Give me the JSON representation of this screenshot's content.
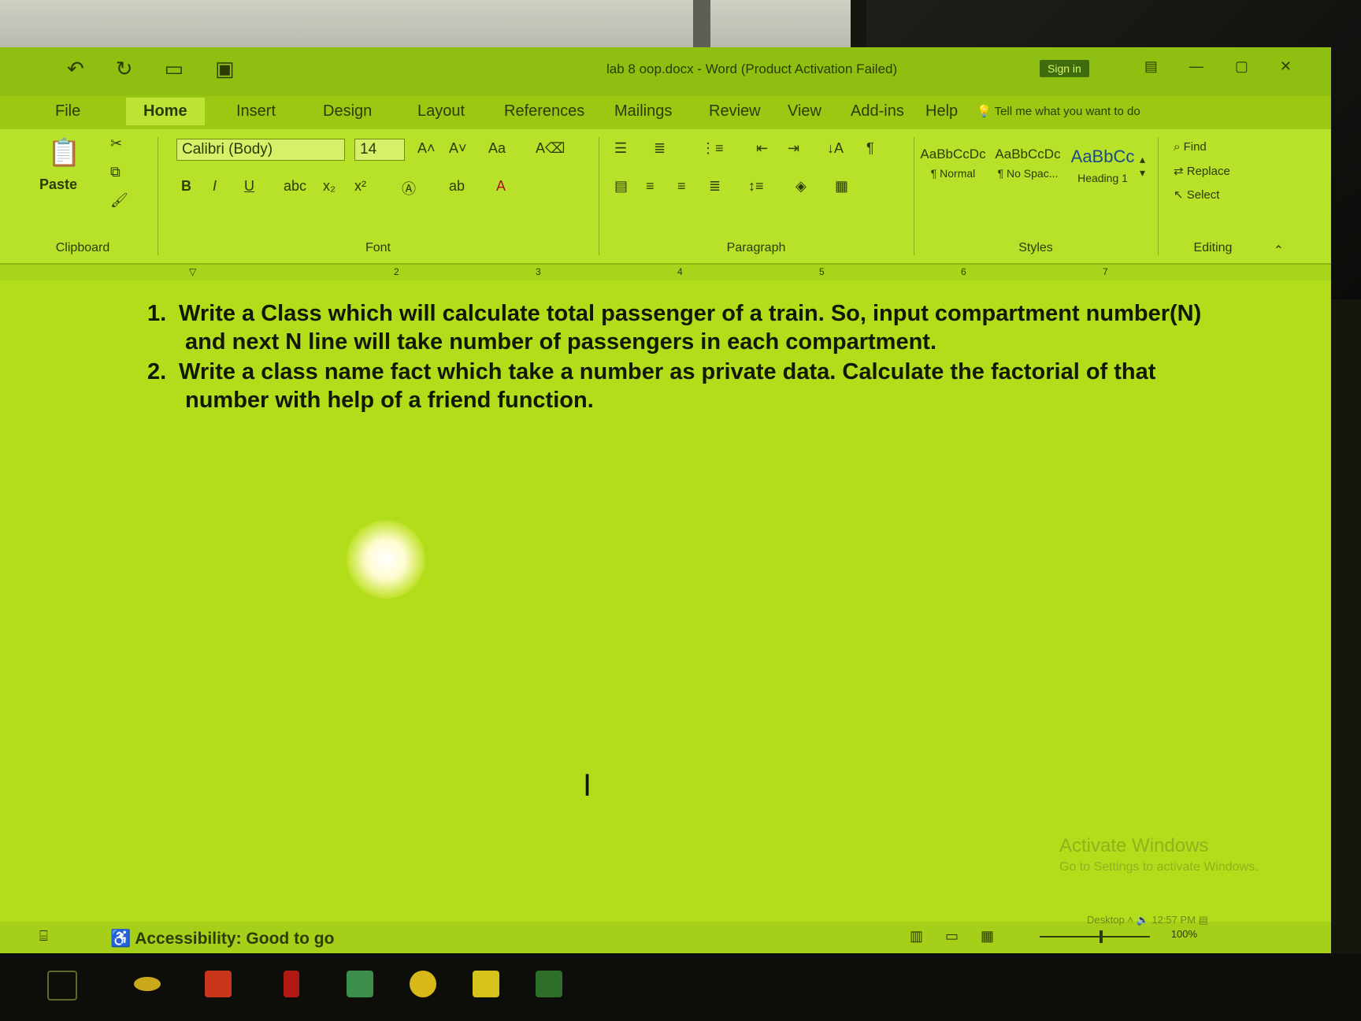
{
  "window": {
    "doc_title": "lab 8 oop.docx - Word (Product Activation Failed)",
    "sign_in": "Sign in",
    "tell_me": "Tell me what you want to do"
  },
  "tabs": [
    "File",
    "Home",
    "Insert",
    "Design",
    "Layout",
    "References",
    "Mailings",
    "Review",
    "View",
    "Add-ins",
    "Help"
  ],
  "ribbon": {
    "clipboard": {
      "label": "Clipboard",
      "paste": "Paste"
    },
    "font": {
      "label": "Font",
      "family": "Calibri (Body)",
      "size": "14",
      "bold": "B",
      "italic": "I",
      "underline": "U",
      "change_case": "Aa"
    },
    "paragraph": {
      "label": "Paragraph"
    },
    "styles": {
      "label": "Styles",
      "items": [
        {
          "sample": "AaBbCcDc",
          "name": "¶ Normal"
        },
        {
          "sample": "AaBbCcDc",
          "name": "¶ No Spac..."
        },
        {
          "sample": "AaBbCc",
          "name": "Heading 1"
        }
      ]
    },
    "editing": {
      "label": "Editing",
      "find": "Find",
      "replace": "Replace",
      "select": "Select"
    }
  },
  "document": {
    "items": [
      {
        "number": "1.",
        "text": "Write a Class which will calculate total passenger of a train. So, input compartment number(N) and next N line will take number of passengers in each compartment."
      },
      {
        "number": "2.",
        "text": "Write a class name fact which take a number as private data. Calculate the factorial of that number with help of a friend function."
      }
    ]
  },
  "watermark": {
    "title": "Activate Windows",
    "subtitle": "Go to Settings to activate Windows."
  },
  "statusbar": {
    "accessibility": "Accessibility: Good to go",
    "zoom": "100%"
  },
  "tray": {
    "desktop": "Desktop",
    "time": "12:57 PM"
  },
  "colors": {
    "screen_tint": "#b3dc1a",
    "text": "#111803"
  }
}
